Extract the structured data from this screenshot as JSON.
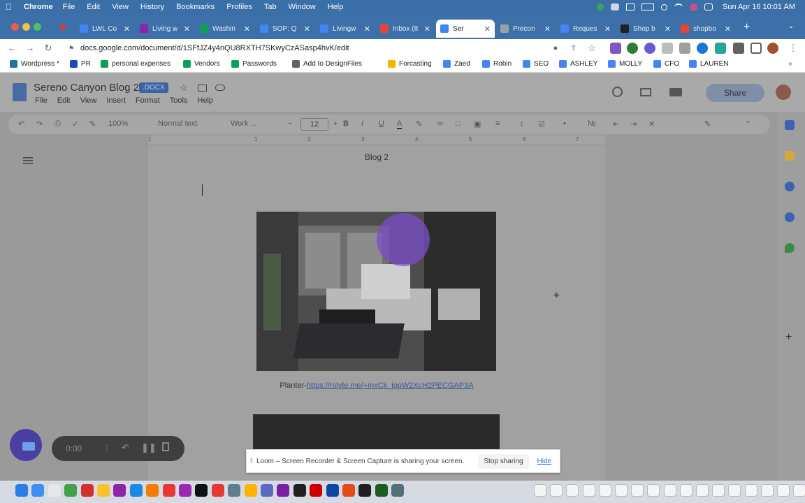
{
  "menubar": {
    "app": "Chrome",
    "items": [
      "File",
      "Edit",
      "View",
      "History",
      "Bookmarks",
      "Profiles",
      "Tab",
      "Window",
      "Help"
    ],
    "clock": "Sun Apr 16  10:01 AM"
  },
  "tabs": [
    {
      "label": "LWL Co",
      "color": "#4285f4"
    },
    {
      "label": "Living w",
      "color": "#8e24aa"
    },
    {
      "label": "Washin",
      "color": "#0f9d58"
    },
    {
      "label": "SOP: Q",
      "color": "#4285f4"
    },
    {
      "label": "Livingw",
      "color": "#4285f4"
    },
    {
      "label": "Inbox (8",
      "color": "#ea4335"
    },
    {
      "label": "Ser",
      "color": "#4285f4",
      "active": true
    },
    {
      "label": "Precon",
      "color": "#9aa0a6"
    },
    {
      "label": "Reques",
      "color": "#4285f4"
    },
    {
      "label": "Shop b",
      "color": "#202124"
    },
    {
      "label": "shopbo",
      "color": "#ea4335"
    }
  ],
  "url": "docs.google.com/document/d/1SFfJZ4y4nQU8RXTH7SKwyCzASasp4hvK/edit",
  "bookmarks": [
    {
      "label": "Wordpress *",
      "color": "#21759b"
    },
    {
      "label": "PR",
      "color": "#1a4ab8"
    },
    {
      "label": "personal expenses",
      "color": "#0f9d58"
    },
    {
      "label": "Vendors",
      "color": "#0f9d58"
    },
    {
      "label": "Passwords",
      "color": "#0f9d58"
    },
    {
      "label": "Add to DesignFiles",
      "color": "#5f6368"
    },
    {
      "label": "Forcasting",
      "color": "#f4b400"
    },
    {
      "label": "Zaed",
      "color": "#4285f4"
    },
    {
      "label": "Robin",
      "color": "#4285f4"
    },
    {
      "label": "SEO",
      "color": "#4285f4"
    },
    {
      "label": "ASHLEY",
      "color": "#4285f4"
    },
    {
      "label": "MOLLY",
      "color": "#4285f4"
    },
    {
      "label": "CFO",
      "color": "#4285f4"
    },
    {
      "label": "LAUREN",
      "color": "#4285f4"
    }
  ],
  "doc": {
    "title": "Sereno Canyon Blog 2",
    "badge": ".DOCX",
    "menu": [
      "File",
      "Edit",
      "View",
      "Insert",
      "Format",
      "Tools",
      "Help"
    ],
    "share": "Share",
    "zoom": "100%",
    "style": "Normal text",
    "font": "Work ...",
    "font_size": "12",
    "ruler": [
      "1",
      "1",
      "2",
      "3",
      "4",
      "5",
      "6",
      "7"
    ],
    "header_text": "Blog 2",
    "caption_prefix": "Planter-",
    "caption_link": "https://rstyle.me/+mxCk_jopW2XcH2PECGAP3A"
  },
  "loom": {
    "timer": "0:00",
    "banner": "Loom – Screen Recorder & Screen Capture is sharing your screen.",
    "stop": "Stop sharing",
    "hide": "Hide"
  }
}
